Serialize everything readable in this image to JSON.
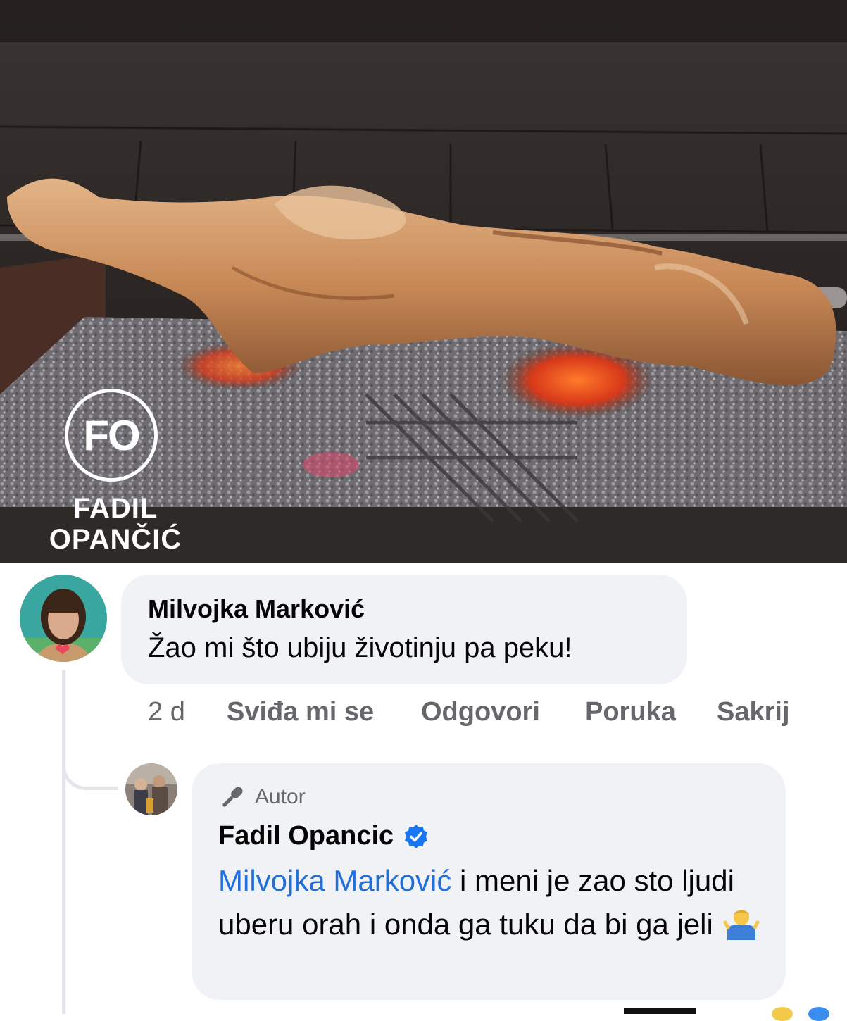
{
  "photo": {
    "watermark_initials": "FO",
    "watermark_name_line1": "FADIL",
    "watermark_name_line2": "OPANČIĆ"
  },
  "comment": {
    "author": "Milvojka Marković",
    "text": "Žao mi što ubiju životinju pa peku!",
    "time": "2 d",
    "actions": {
      "like": "Sviđa mi se",
      "reply": "Odgovori",
      "message": "Poruka",
      "hide": "Sakrij"
    }
  },
  "reply": {
    "badge": "Autor",
    "author": "Fadil Opancic",
    "verified": true,
    "mention": "Milvojka Marković",
    "text": " i meni je zao sto ljudi uberu orah i onda ga tuku da bi ga jeli "
  },
  "colors": {
    "bubble": "#f0f2f5",
    "mention": "#216fdb",
    "secondary_text": "#65676b",
    "verified": "#1877f2"
  }
}
